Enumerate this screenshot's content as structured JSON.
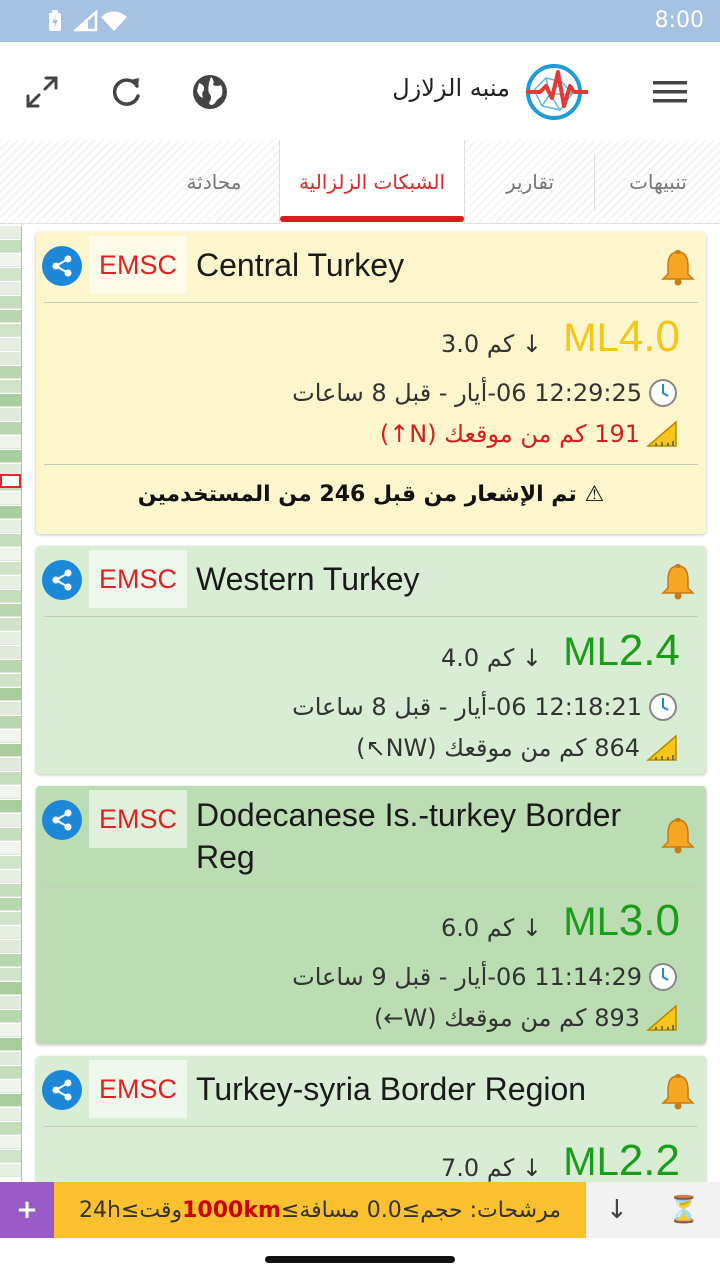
{
  "status": {
    "time": "8:00"
  },
  "app": {
    "title": "منبه الزلازل"
  },
  "toolbar": {
    "fullscreen_icon": "fullscreen-icon",
    "refresh_icon": "refresh-icon",
    "globe_icon": "globe-icon",
    "menu_icon": "menu-icon"
  },
  "tabs": [
    {
      "label": "تنبيهات"
    },
    {
      "label": "تقارير"
    },
    {
      "label": "الشبكات الزلزالية",
      "active": true
    },
    {
      "label": "محادثة"
    }
  ],
  "colors": {
    "accent_red": "#e01b1b",
    "magnitude_yellow": "#f5c518",
    "magnitude_green": "#1a9e1a",
    "card_yellow": "#fdf6cd",
    "card_green_light": "#d8edd3",
    "card_green_dark": "#bcdcb4"
  },
  "cards": [
    {
      "source": "EMSC",
      "location": "Central Turkey",
      "ml": "ML",
      "magnitude": "4.0",
      "depth_value": "3.0",
      "depth_unit": "كم",
      "time": "12:29:25 06-أيار - قبل 8 ساعات",
      "distance": "191 كم من موقعك (N↑)",
      "notice": "تم الإشعار من قبل 246 من المستخدمين"
    },
    {
      "source": "EMSC",
      "location": "Western Turkey",
      "ml": "ML",
      "magnitude": "2.4",
      "depth_value": "4.0",
      "depth_unit": "كم",
      "time": "12:18:21 06-أيار - قبل 8 ساعات",
      "distance": "864 كم من موقعك (NW↖)"
    },
    {
      "source": "EMSC",
      "location": "Dodecanese Is.-turkey Border Reg",
      "ml": "ML",
      "magnitude": "3.0",
      "depth_value": "6.0",
      "depth_unit": "كم",
      "time": "11:14:29 06-أيار - قبل 9 ساعات",
      "distance": "893 كم من موقعك (W←)"
    },
    {
      "source": "EMSC",
      "location": "Turkey-syria Border Region",
      "ml": "ML",
      "magnitude": "2.2",
      "depth_value": "7.0",
      "depth_unit": "كم"
    }
  ],
  "filter": {
    "prefix": "مرشحات: حجم≥0.0 مسافة≥",
    "distance": "1000km",
    "suffix": " وقت≥24h",
    "plus_label": "+",
    "down_label": "↓",
    "hourglass_label": "⏳"
  }
}
